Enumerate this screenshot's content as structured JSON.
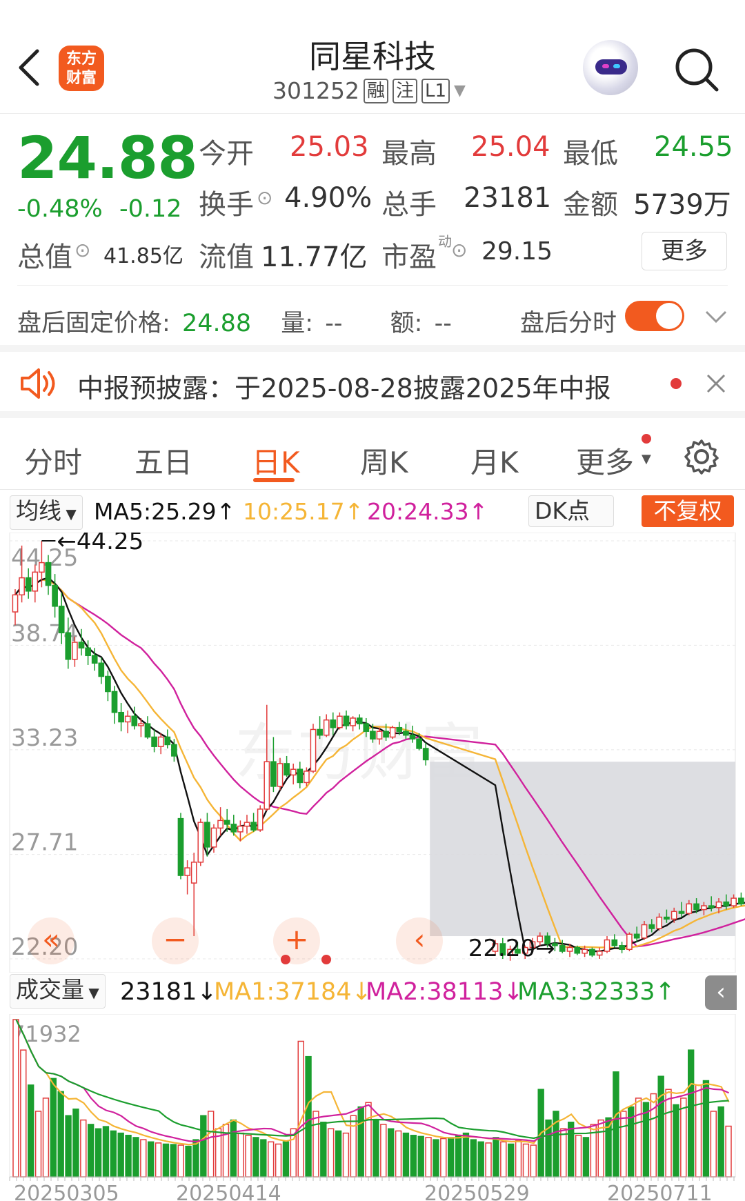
{
  "header": {
    "title": "同星科技",
    "code": "301252",
    "tags": [
      "融",
      "注",
      "L1"
    ],
    "logo_text": [
      "东方",
      "财富"
    ]
  },
  "quote": {
    "price": "24.88",
    "change_pct": "-0.48%",
    "change": "-0.12",
    "open_label": "今开",
    "open": "25.03",
    "high_label": "最高",
    "high": "25.04",
    "low_label": "最低",
    "low": "24.55",
    "turnover_label": "换手",
    "turnover": "4.90%",
    "volume_label": "总手",
    "volume": "23181",
    "amount_label": "金额",
    "amount": "5739万",
    "mktcap_label": "总值",
    "mktcap": "41.85亿",
    "float_label": "流值",
    "float": "11.77亿",
    "pe_label": "市盈",
    "pe_sup": "动",
    "pe": "29.15",
    "more_label": "更多"
  },
  "after_hours": {
    "price_label": "盘后固定价格:",
    "price": "24.88",
    "vol_label": "量:",
    "vol": "--",
    "amt_label": "额:",
    "amt": "--",
    "switch_label": "盘后分时"
  },
  "notice": {
    "text": "中报预披露：于2025-08-28披露2025年中报"
  },
  "tabs": [
    "分时",
    "五日",
    "日K",
    "周K",
    "月K",
    "更多"
  ],
  "ma_bar": {
    "mode": "均线",
    "ma5": "MA5:25.29↑",
    "ma10": "10:25.17↑",
    "ma20": "20:24.33↑",
    "dk": "DK点",
    "adjust": "不复权"
  },
  "volume_bar": {
    "label": "成交量",
    "vol": "23181↓",
    "ma1": "MA1:37184↓",
    "ma2": "MA2:38113↓",
    "ma3": "MA3:32333↑"
  },
  "chart_data": [
    {
      "type": "candlestick",
      "y_ticks": [
        "44.25",
        "38.74",
        "33.23",
        "27.71",
        "22.20"
      ],
      "ylim": [
        22.2,
        44.25
      ],
      "annotations": [
        "44.25",
        "22.20"
      ],
      "ohlc": [
        [
          40.5,
          41.7,
          39.8,
          41.4
        ],
        [
          41.4,
          44.0,
          41.0,
          42.3
        ],
        [
          42.3,
          42.8,
          41.2,
          41.6
        ],
        [
          41.6,
          43.0,
          41.0,
          42.6
        ],
        [
          42.6,
          44.25,
          41.8,
          43.1
        ],
        [
          43.1,
          43.5,
          41.4,
          41.9
        ],
        [
          41.9,
          42.5,
          40.2,
          40.8
        ],
        [
          40.8,
          41.5,
          38.8,
          39.4
        ],
        [
          39.4,
          40.2,
          37.5,
          38.0
        ],
        [
          38.0,
          39.2,
          37.6,
          38.9
        ],
        [
          38.9,
          39.6,
          38.2,
          38.6
        ],
        [
          38.6,
          39.0,
          37.7,
          38.2
        ],
        [
          38.2,
          38.6,
          37.4,
          37.8
        ],
        [
          37.8,
          38.1,
          36.7,
          37.1
        ],
        [
          37.1,
          37.4,
          35.8,
          36.3
        ],
        [
          36.3,
          36.6,
          34.6,
          35.2
        ],
        [
          35.2,
          35.7,
          34.2,
          34.7
        ],
        [
          34.7,
          35.3,
          34.1,
          35.0
        ],
        [
          35.0,
          35.5,
          34.3,
          34.5
        ],
        [
          34.5,
          34.9,
          33.9,
          34.6
        ],
        [
          34.6,
          35.0,
          33.8,
          33.9
        ],
        [
          33.9,
          34.3,
          33.1,
          33.4
        ],
        [
          33.4,
          34.1,
          33.0,
          33.9
        ],
        [
          33.9,
          34.3,
          33.3,
          33.5
        ],
        [
          33.5,
          33.8,
          32.6,
          32.9
        ],
        [
          29.6,
          29.9,
          26.4,
          26.6
        ],
        [
          26.6,
          27.4,
          25.6,
          27.0
        ],
        [
          26.2,
          27.8,
          23.4,
          27.3
        ],
        [
          27.3,
          29.6,
          27.1,
          29.4
        ],
        [
          29.4,
          29.9,
          27.6,
          28.1
        ],
        [
          28.1,
          29.3,
          27.8,
          29.1
        ],
        [
          29.1,
          30.2,
          28.7,
          29.5
        ],
        [
          29.5,
          30.1,
          28.9,
          29.3
        ],
        [
          29.3,
          29.8,
          28.7,
          28.9
        ],
        [
          28.9,
          29.5,
          28.4,
          29.2
        ],
        [
          29.2,
          29.8,
          28.8,
          29.4
        ],
        [
          29.4,
          29.9,
          28.9,
          29.0
        ],
        [
          29.0,
          30.3,
          28.9,
          30.1
        ],
        [
          30.1,
          35.6,
          30.0,
          32.6
        ],
        [
          32.6,
          33.9,
          31.0,
          31.3
        ],
        [
          31.3,
          32.8,
          31.1,
          32.5
        ],
        [
          32.5,
          32.9,
          31.8,
          31.9
        ],
        [
          31.9,
          32.5,
          31.4,
          32.2
        ],
        [
          32.2,
          32.6,
          31.2,
          31.5
        ],
        [
          31.5,
          32.3,
          31.3,
          32.1
        ],
        [
          32.1,
          34.6,
          32.0,
          34.3
        ],
        [
          34.3,
          35.0,
          33.8,
          34.0
        ],
        [
          34.0,
          35.1,
          33.9,
          34.8
        ],
        [
          34.8,
          35.2,
          34.0,
          34.4
        ],
        [
          34.4,
          35.2,
          34.3,
          35.0
        ],
        [
          35.0,
          35.3,
          34.3,
          34.5
        ],
        [
          34.5,
          35.0,
          34.2,
          34.9
        ],
        [
          34.9,
          35.1,
          34.3,
          34.6
        ],
        [
          34.6,
          34.9,
          33.9,
          34.2
        ],
        [
          34.2,
          34.6,
          33.6,
          33.8
        ],
        [
          33.8,
          34.4,
          33.5,
          34.2
        ],
        [
          34.2,
          34.6,
          33.7,
          33.9
        ],
        [
          33.9,
          34.5,
          33.8,
          34.4
        ],
        [
          34.4,
          34.7,
          34.0,
          34.2
        ],
        [
          34.2,
          34.6,
          33.8,
          34.0
        ],
        [
          34.0,
          34.5,
          33.6,
          33.8
        ],
        [
          33.8,
          34.1,
          33.2,
          33.3
        ],
        [
          33.3,
          33.6,
          32.4,
          32.7
        ],
        [
          22.6,
          23.2,
          22.4,
          23.0
        ],
        [
          23.0,
          23.3,
          22.2,
          22.4
        ],
        [
          22.4,
          22.9,
          22.1,
          22.7
        ],
        [
          22.7,
          23.1,
          22.4,
          22.5
        ],
        [
          22.5,
          22.9,
          22.2,
          22.8
        ],
        [
          22.8,
          23.3,
          22.6,
          23.1
        ],
        [
          23.1,
          23.6,
          22.9,
          23.4
        ],
        [
          23.4,
          23.6,
          22.8,
          23.0
        ],
        [
          23.0,
          23.3,
          22.6,
          22.9
        ],
        [
          22.9,
          23.2,
          22.5,
          22.6
        ],
        [
          22.6,
          23.0,
          22.3,
          22.8
        ],
        [
          22.8,
          22.9,
          22.4,
          22.5
        ],
        [
          22.5,
          22.9,
          22.3,
          22.7
        ],
        [
          22.7,
          22.8,
          22.3,
          22.4
        ],
        [
          22.4,
          22.8,
          22.2,
          22.6
        ],
        [
          22.6,
          23.4,
          22.5,
          23.2
        ],
        [
          23.2,
          23.5,
          22.8,
          22.9
        ],
        [
          22.9,
          23.1,
          22.5,
          22.7
        ],
        [
          22.7,
          23.6,
          22.6,
          23.5
        ],
        [
          23.5,
          23.9,
          23.1,
          23.3
        ],
        [
          23.3,
          24.2,
          23.2,
          24.0
        ],
        [
          24.0,
          24.3,
          23.6,
          23.8
        ],
        [
          23.8,
          24.6,
          23.7,
          24.4
        ],
        [
          24.4,
          24.8,
          24.1,
          24.3
        ],
        [
          24.3,
          24.9,
          24.1,
          24.7
        ],
        [
          24.7,
          25.2,
          24.4,
          24.6
        ],
        [
          24.6,
          25.3,
          24.5,
          25.1
        ],
        [
          25.1,
          25.4,
          24.6,
          24.8
        ],
        [
          24.8,
          25.2,
          24.5,
          25.0
        ],
        [
          25.0,
          25.5,
          24.7,
          24.9
        ],
        [
          24.9,
          25.4,
          24.6,
          25.2
        ],
        [
          25.2,
          25.6,
          24.8,
          25.0
        ],
        [
          25.0,
          25.6,
          24.9,
          25.4
        ],
        [
          25.4,
          25.7,
          25.0,
          25.1
        ],
        [
          25.1,
          25.6,
          24.9,
          25.3
        ],
        [
          25.03,
          25.04,
          24.55,
          24.88
        ]
      ],
      "ma5_last": 25.29,
      "ma10_last": 25.17,
      "ma20_last": 24.33
    },
    {
      "type": "bar",
      "name": "成交量",
      "y_max_label": "71932",
      "x_labels": [
        "20250305",
        "20250414",
        "20250529",
        "20250711"
      ],
      "values": [
        71932,
        58000,
        42000,
        30000,
        36000,
        45000,
        39000,
        28000,
        31000,
        26000,
        24000,
        22000,
        23000,
        21000,
        20000,
        19000,
        18000,
        17000,
        16000,
        15500,
        15000,
        14800,
        14500,
        14000,
        17000,
        28000,
        30000,
        22000,
        24000,
        26000,
        20000,
        19000,
        18000,
        17000,
        16000,
        15000,
        16000,
        22000,
        62000,
        55000,
        30000,
        25000,
        22000,
        21000,
        20000,
        28000,
        32000,
        34000,
        26000,
        24000,
        22000,
        21000,
        20000,
        19000,
        18500,
        18000,
        17000,
        17500,
        18000,
        19000,
        20000,
        17000,
        16000,
        15500,
        18000,
        16000,
        15000,
        16500,
        15000,
        14500,
        40000,
        26000,
        30000,
        22000,
        25000,
        19000,
        18000,
        24000,
        26000,
        27000,
        48000,
        30000,
        32000,
        36000,
        34000,
        38000,
        46000,
        40000,
        33000,
        36000,
        58000,
        42000,
        44000,
        30000,
        32000,
        23181
      ],
      "ma1_last": 37184,
      "ma2_last": 38113,
      "ma3_last": 32333
    }
  ],
  "colors": {
    "up": "#e23b3b",
    "down": "#1b9e2e",
    "accent": "#f25a1f",
    "ma5": "#111111",
    "ma10": "#f5b536",
    "ma20": "#d0219d"
  }
}
